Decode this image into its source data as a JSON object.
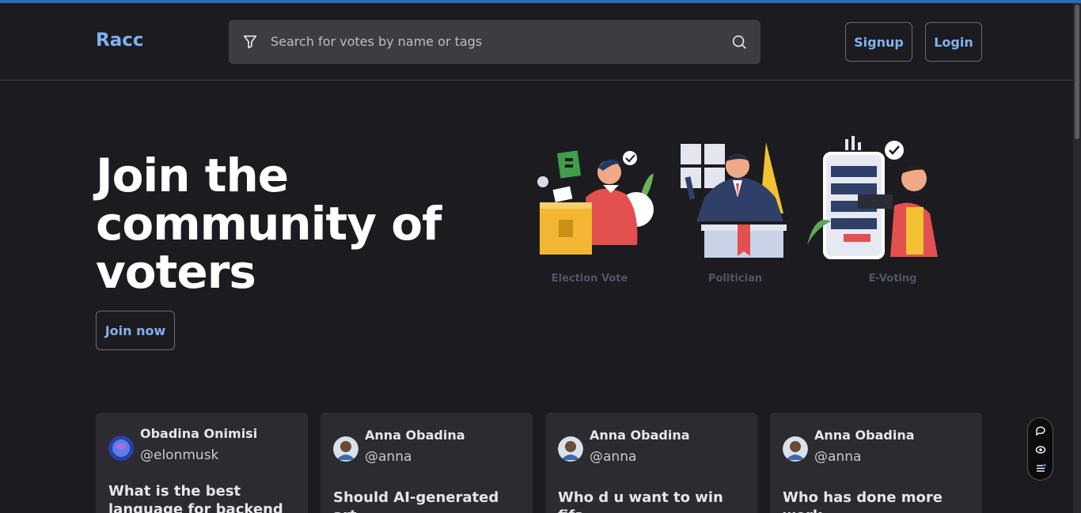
{
  "header": {
    "logo": "Racc",
    "search_placeholder": "Search for votes by name or tags",
    "signup_label": "Signup",
    "login_label": "Login"
  },
  "hero": {
    "title": "Join the community of voters",
    "join_label": "Join now",
    "illustrations": [
      {
        "caption": "Election Vote",
        "icon": "ballot-box-illustration"
      },
      {
        "caption": "Politician",
        "icon": "podium-speaker-illustration"
      },
      {
        "caption": "E-Voting",
        "icon": "phone-voting-illustration"
      }
    ]
  },
  "polls": [
    {
      "name": "Obadina Onimisi",
      "handle": "@elonmusk",
      "question": "What is the best language for backend"
    },
    {
      "name": "Anna Obadina",
      "handle": "@anna",
      "question": "Should AI-generated art"
    },
    {
      "name": "Anna Obadina",
      "handle": "@anna",
      "question": "Who d u want to win fifa"
    },
    {
      "name": "Anna Obadina",
      "handle": "@anna",
      "question": "Who has done more work"
    }
  ],
  "colors": {
    "background": "#1c1b20",
    "accent": "#7fb2f0",
    "card": "#2c2b31"
  }
}
